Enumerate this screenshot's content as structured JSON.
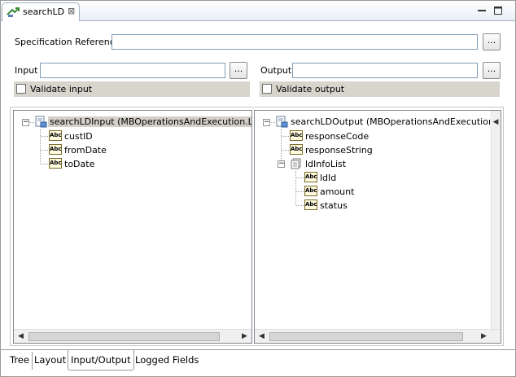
{
  "editor": {
    "tab_title": "searchLD",
    "close_glyph": "⊠",
    "icons": {
      "tab": "operation-icon",
      "minimize": "minimize-icon",
      "maximize": "maximize-icon"
    }
  },
  "form": {
    "spec_ref_label": "Specification Reference",
    "spec_ref_value": "",
    "input_label": "Input",
    "input_value": "",
    "output_label": "Output",
    "output_value": "",
    "browse_label": "...",
    "validate_input_label": "Validate input",
    "validate_input_checked": false,
    "validate_output_label": "Validate output",
    "validate_output_checked": false
  },
  "input_tree": {
    "root": "searchLDInput (MBOperationsAndExecution.Loans.",
    "children": [
      "custID",
      "fromDate",
      "toDate"
    ]
  },
  "output_tree": {
    "root": "searchLDOutput (MBOperationsAndExecution.Loans",
    "children": [
      "responseCode",
      "responseString"
    ],
    "list_node": "ldInfoList",
    "list_children": [
      "ldId",
      "amount",
      "status"
    ]
  },
  "type_badge": "Abc",
  "expander_glyph": "−",
  "page_tabs": [
    "Tree",
    "Layout",
    "Input/Output",
    "Logged Fields"
  ],
  "active_page_tab": "Input/Output",
  "colors": {
    "tab_gradient_bottom": "#e9eef6",
    "check_row_bg": "#d8d5cc",
    "selection_bg": "#d4d0c8",
    "field_border": "#7f9db9"
  }
}
